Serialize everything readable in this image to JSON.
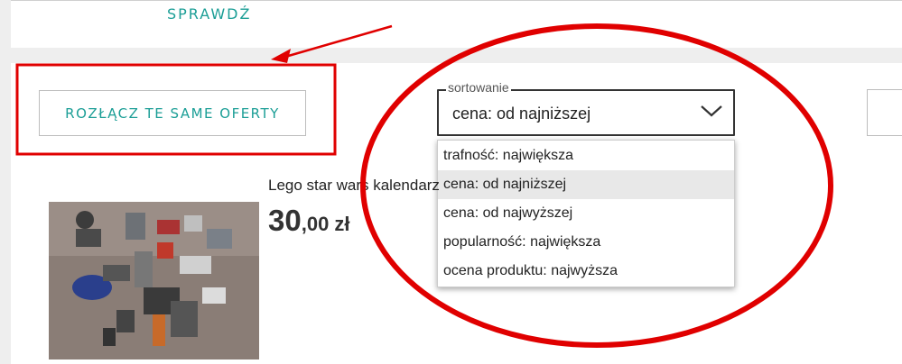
{
  "header": {
    "check_label": "SPRAWDŹ"
  },
  "toolbar": {
    "disconnect_label": "ROZŁĄCZ TE SAME OFERTY"
  },
  "sort": {
    "legend": "sortowanie",
    "selected": "cena: od najniższej",
    "options": [
      "trafność: największa",
      "cena: od najniższej",
      "cena: od najwyższej",
      "popularność: największa",
      "ocena produktu: najwyższa"
    ],
    "highlighted_index": 1
  },
  "product": {
    "title": "Lego star wars kalendarz",
    "price_main": "30",
    "price_fraction": ",00 zł"
  },
  "colors": {
    "accent": "#1b9e96",
    "annotation": "#e00000",
    "page_bg": "#eeeeee"
  },
  "icons": [
    "chevron-down-icon"
  ]
}
